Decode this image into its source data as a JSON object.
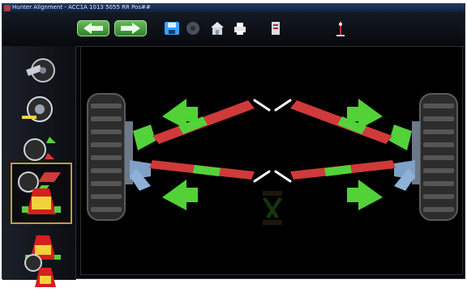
{
  "window": {
    "title": "Hunter Alignment - ACC1A 1013 5055 RR Pos##"
  },
  "toolbar": {
    "back_label": "",
    "forward_label": "",
    "tools": [
      {
        "icon": "save-disk-icon"
      },
      {
        "icon": "gray-disk-icon"
      },
      {
        "icon": "print-house-icon"
      },
      {
        "icon": "printer-icon"
      },
      {
        "icon": "report-icon"
      },
      {
        "icon": "measure-stand-icon"
      }
    ]
  },
  "sidebar": {
    "items": [
      {
        "icon": "spanner-wheel-icon",
        "active": false
      },
      {
        "icon": "wheel-measure-icon",
        "active": false
      },
      {
        "icon": "runout-check-icon",
        "active": false
      },
      {
        "icon": "toe-align-icon",
        "active": true
      },
      {
        "icon": "camber-car-icon",
        "active": false
      },
      {
        "icon": "caster-car-icon",
        "active": false
      },
      {
        "icon": "gauges-icon",
        "active": false
      }
    ]
  },
  "main": {
    "scene": {
      "theme_colors": {
        "background": "#000000",
        "tire": "#2c2c2c",
        "tread": "#555555",
        "green": "#52d236",
        "red": "#d13a3a",
        "steel_blue": "#7fa1c7",
        "highlight": "#ffffff"
      }
    }
  }
}
